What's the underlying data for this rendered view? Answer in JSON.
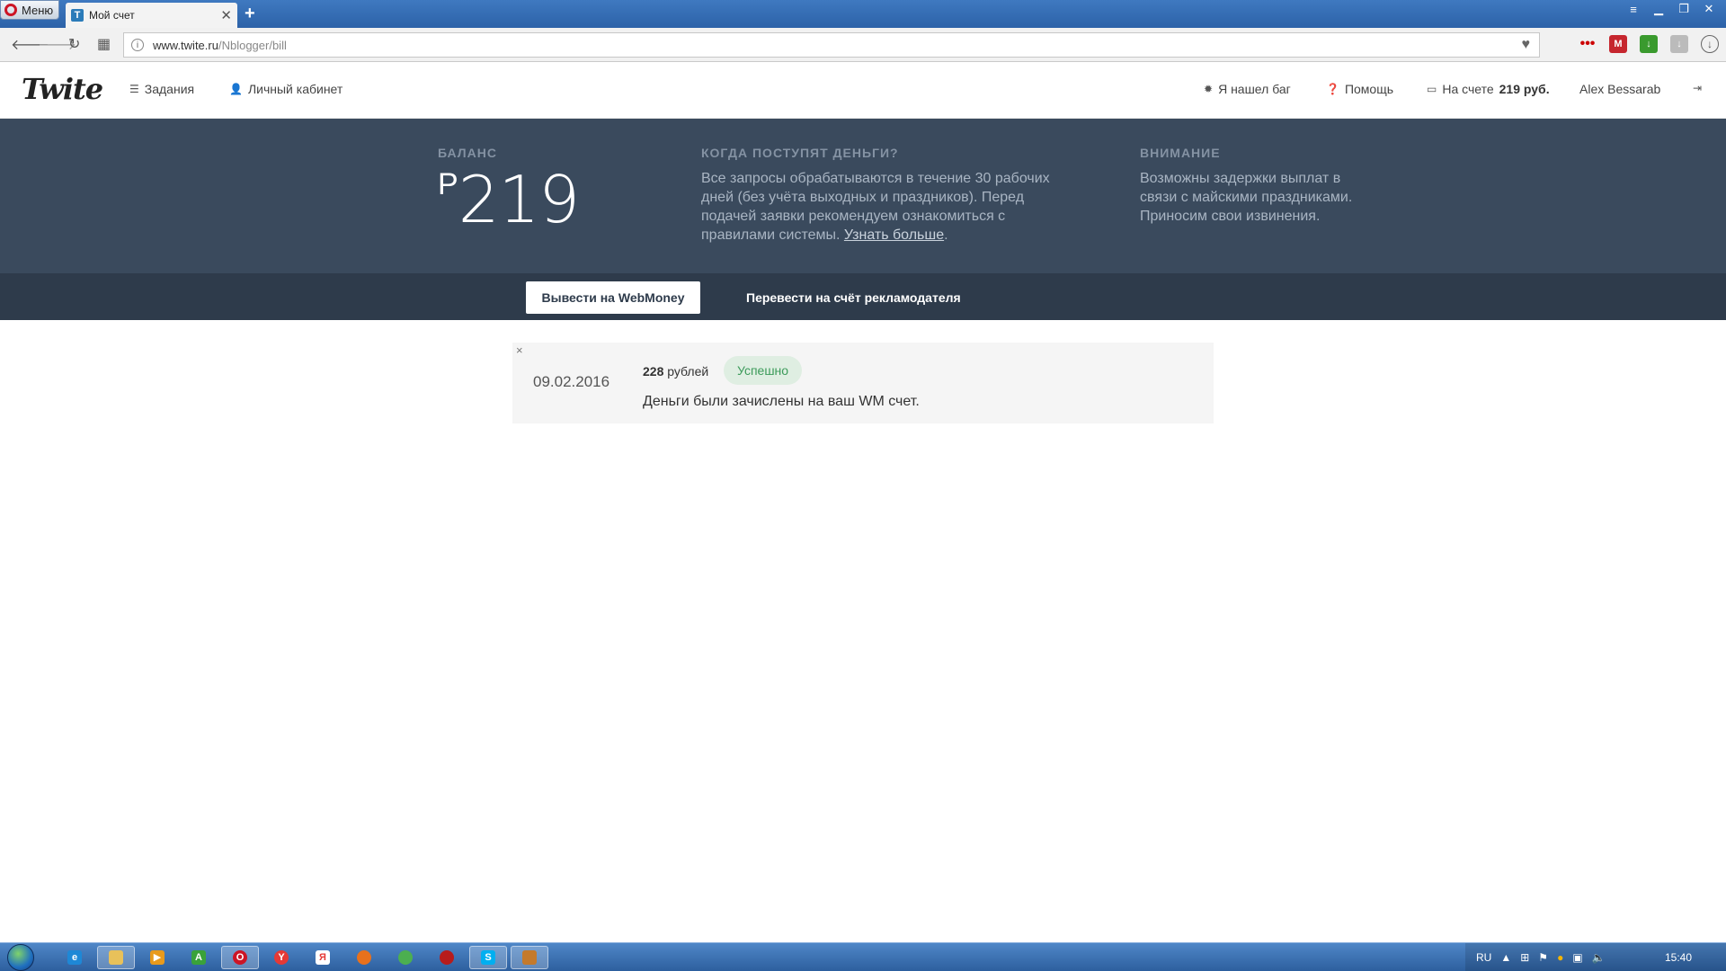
{
  "browser": {
    "menu_label": "Меню",
    "tab_title": "Мой счет",
    "url_host": "www.twite.ru",
    "url_path": "/Nblogger/bill"
  },
  "header": {
    "logo": "Twite",
    "nav": {
      "tasks": "Задания",
      "cabinet": "Личный кабинет",
      "bug": "Я нашел баг",
      "help": "Помощь",
      "balance_prefix": "На счете",
      "balance_value": "219 руб.",
      "user": "Alex Bessarab"
    }
  },
  "balance": {
    "title": "Баланс",
    "currency": "Р",
    "amount": "219"
  },
  "when": {
    "title": "Когда поступят деньги?",
    "text": "Все запросы обрабатываются в течение 30 рабочих дней (без учёта выходных и праздников). Перед подачей заявки рекомендуем ознакомиться с правилами системы. ",
    "link": "Узнать больше",
    "end": "."
  },
  "notice": {
    "title": "Внимание",
    "text": "Возможны задержки выплат в связи с майскими праздниками. Приносим свои извинения."
  },
  "actions": {
    "webmoney": "Вывести на WebMoney",
    "transfer": "Перевести на счёт рекламодателя"
  },
  "transaction": {
    "close": "×",
    "date": "09.02.2016",
    "amount": "228",
    "currency": "рублей",
    "status": "Успешно",
    "description": "Деньги были зачислены на ваш WM счет."
  },
  "taskbar": {
    "lang": "RU",
    "time": "15:40"
  },
  "colors": {
    "band": "#3a4a5d",
    "band_dark": "#2e3b4b",
    "success_bg": "#dfeee2",
    "success_text": "#3c9b5a"
  }
}
